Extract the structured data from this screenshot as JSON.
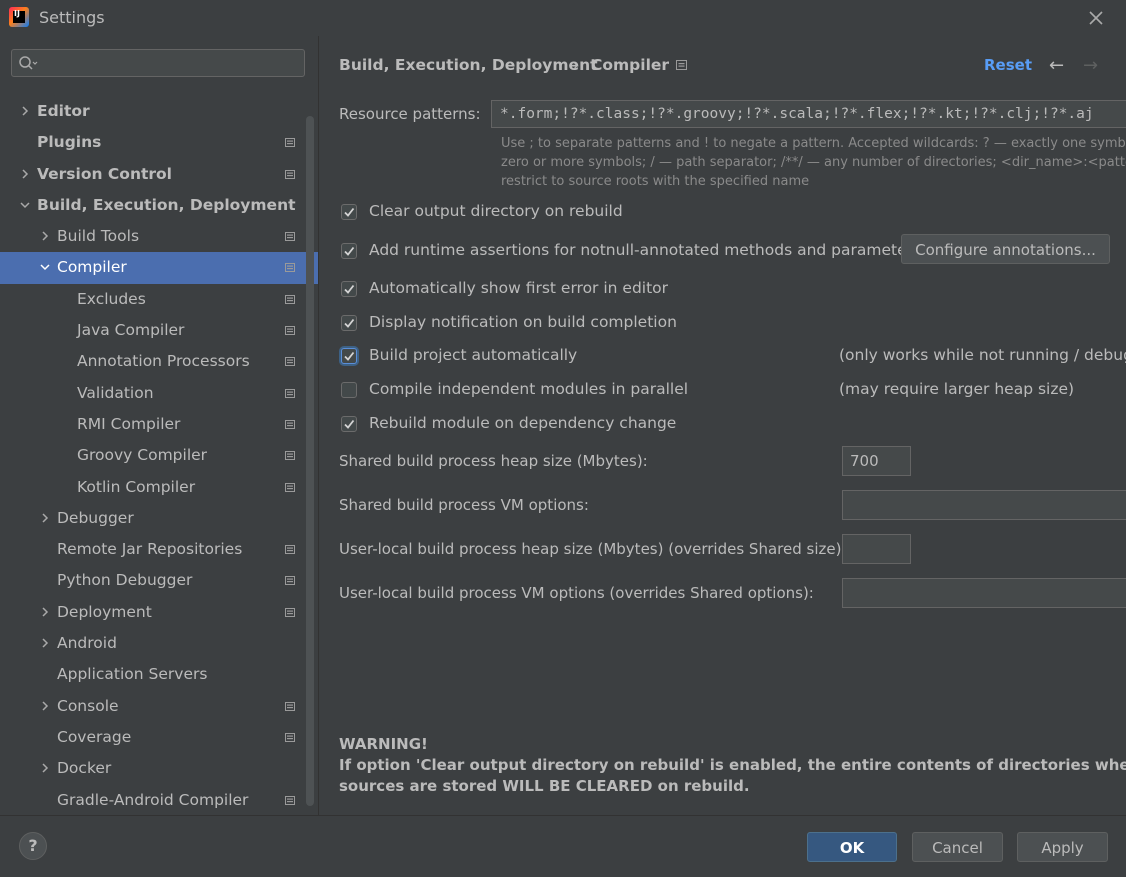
{
  "window": {
    "title": "Settings",
    "app_icon": "intellij-idea-icon",
    "close_icon": "close-icon"
  },
  "search": {
    "value": "",
    "placeholder": "",
    "icon": "search-icon"
  },
  "sidebar": {
    "items": [
      {
        "label": "Editor",
        "level": 0,
        "bold": true,
        "chevron": "right",
        "proj": false,
        "selected": false
      },
      {
        "label": "Plugins",
        "level": 0,
        "bold": true,
        "chevron": "none",
        "proj": true,
        "selected": false
      },
      {
        "label": "Version Control",
        "level": 0,
        "bold": true,
        "chevron": "right",
        "proj": true,
        "selected": false
      },
      {
        "label": "Build, Execution, Deployment",
        "level": 0,
        "bold": true,
        "chevron": "down",
        "proj": false,
        "selected": false
      },
      {
        "label": "Build Tools",
        "level": 1,
        "bold": false,
        "chevron": "right",
        "proj": true,
        "selected": false
      },
      {
        "label": "Compiler",
        "level": 1,
        "bold": false,
        "chevron": "down",
        "proj": true,
        "selected": true
      },
      {
        "label": "Excludes",
        "level": 2,
        "bold": false,
        "chevron": "none",
        "proj": true,
        "selected": false
      },
      {
        "label": "Java Compiler",
        "level": 2,
        "bold": false,
        "chevron": "none",
        "proj": true,
        "selected": false
      },
      {
        "label": "Annotation Processors",
        "level": 2,
        "bold": false,
        "chevron": "none",
        "proj": true,
        "selected": false
      },
      {
        "label": "Validation",
        "level": 2,
        "bold": false,
        "chevron": "none",
        "proj": true,
        "selected": false
      },
      {
        "label": "RMI Compiler",
        "level": 2,
        "bold": false,
        "chevron": "none",
        "proj": true,
        "selected": false
      },
      {
        "label": "Groovy Compiler",
        "level": 2,
        "bold": false,
        "chevron": "none",
        "proj": true,
        "selected": false
      },
      {
        "label": "Kotlin Compiler",
        "level": 2,
        "bold": false,
        "chevron": "none",
        "proj": true,
        "selected": false
      },
      {
        "label": "Debugger",
        "level": 1,
        "bold": false,
        "chevron": "right",
        "proj": false,
        "selected": false
      },
      {
        "label": "Remote Jar Repositories",
        "level": 1,
        "bold": false,
        "chevron": "none",
        "proj": true,
        "selected": false
      },
      {
        "label": "Python Debugger",
        "level": 1,
        "bold": false,
        "chevron": "none",
        "proj": true,
        "selected": false
      },
      {
        "label": "Deployment",
        "level": 1,
        "bold": false,
        "chevron": "right",
        "proj": true,
        "selected": false
      },
      {
        "label": "Android",
        "level": 1,
        "bold": false,
        "chevron": "right",
        "proj": false,
        "selected": false
      },
      {
        "label": "Application Servers",
        "level": 1,
        "bold": false,
        "chevron": "none",
        "proj": false,
        "selected": false
      },
      {
        "label": "Console",
        "level": 1,
        "bold": false,
        "chevron": "right",
        "proj": true,
        "selected": false
      },
      {
        "label": "Coverage",
        "level": 1,
        "bold": false,
        "chevron": "none",
        "proj": true,
        "selected": false
      },
      {
        "label": "Docker",
        "level": 1,
        "bold": false,
        "chevron": "right",
        "proj": false,
        "selected": false
      },
      {
        "label": "Gradle-Android Compiler",
        "level": 1,
        "bold": false,
        "chevron": "none",
        "proj": true,
        "selected": false
      }
    ]
  },
  "header": {
    "breadcrumb_parent": "Build, Execution, Deployment",
    "breadcrumb_sep": "›",
    "breadcrumb_current": "Compiler",
    "reset": "Reset",
    "back_arrow": "←",
    "forward_arrow": "→"
  },
  "resource": {
    "label": "Resource patterns:",
    "value": "*.form;!?*.class;!?*.groovy;!?*.scala;!?*.flex;!?*.kt;!?*.clj;!?*.aj",
    "hint_1": "Use ; to separate patterns and ! to negate a pattern. Accepted wildcards: ? — exactly one symbol; * —",
    "hint_2": "zero or more symbols; / — path separator; /**/ — any number of directories; <dir_name>:<pattern>",
    "hint_3": "restrict to source roots with the specified name"
  },
  "options": [
    {
      "label": "Clear output directory on rebuild",
      "checked": true,
      "note": ""
    },
    {
      "label": "Add runtime assertions for notnull-annotated methods and parameters",
      "checked": true,
      "note": ""
    },
    {
      "label": "Automatically show first error in editor",
      "checked": true,
      "note": ""
    },
    {
      "label": "Display notification on build completion",
      "checked": true,
      "note": ""
    },
    {
      "label": "Build project automatically",
      "checked": true,
      "note": "(only works while not running / debugg"
    },
    {
      "label": "Compile independent modules in parallel",
      "checked": false,
      "note": "(may require larger heap size)"
    },
    {
      "label": "Rebuild module on dependency change",
      "checked": true,
      "note": ""
    }
  ],
  "configure_button": "Configure annotations...",
  "fields": [
    {
      "label": "Shared build process heap size (Mbytes):",
      "value": "700"
    },
    {
      "label": "Shared build process VM options:",
      "value": ""
    },
    {
      "label": "User-local build process heap size (Mbytes) (overrides Shared size):",
      "value": ""
    },
    {
      "label": "User-local build process VM options (overrides Shared options):",
      "value": ""
    }
  ],
  "warning": {
    "title": "WARNING!",
    "line_1": "If option 'Clear output directory on rebuild' is enabled, the entire contents of directories where generated",
    "line_2": "sources are stored WILL BE CLEARED on rebuild."
  },
  "footer": {
    "help": "?",
    "ok": "OK",
    "cancel": "Cancel",
    "apply": "Apply"
  },
  "colors": {
    "accent": "#589df6",
    "selection": "#4b6eaf",
    "primary_button": "#365880",
    "background": "#3c3f41"
  }
}
